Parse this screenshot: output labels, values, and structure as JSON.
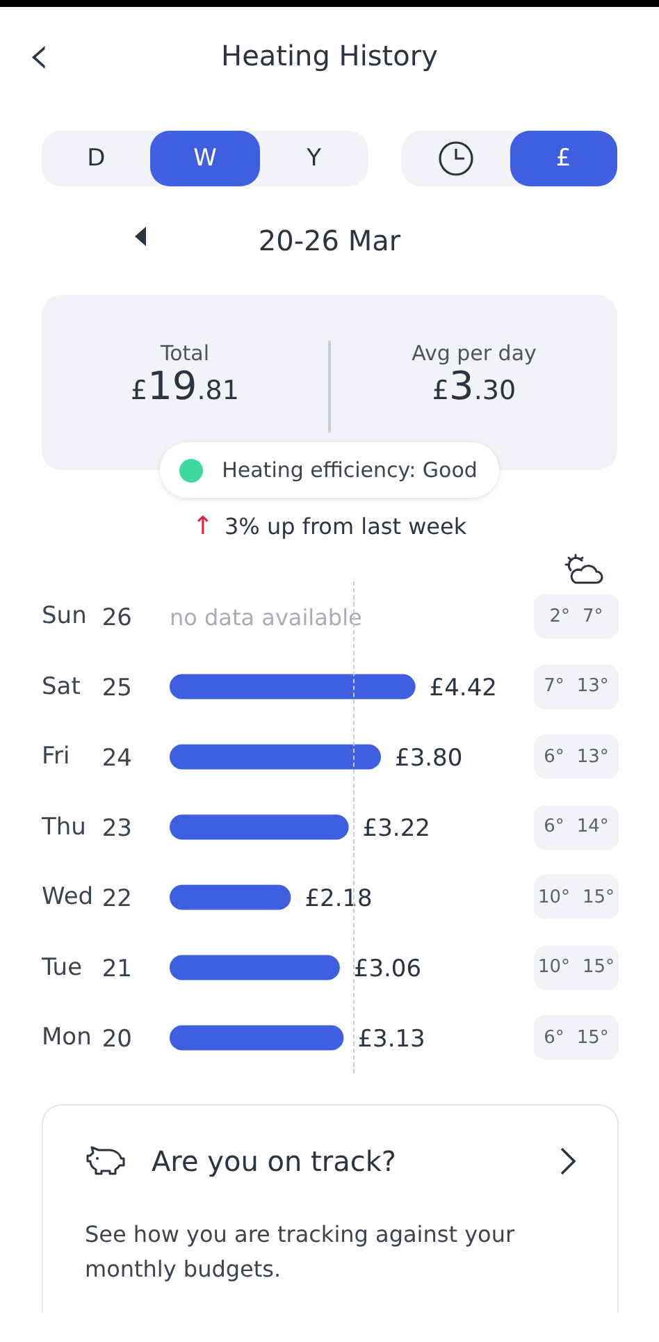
{
  "header": {
    "back_icon": "‹",
    "title": "Heating History"
  },
  "period_tabs": [
    {
      "label": "D",
      "selected": false
    },
    {
      "label": "W",
      "selected": true
    },
    {
      "label": "Y",
      "selected": false
    }
  ],
  "unit_tabs": [
    {
      "kind": "clock",
      "selected": false
    },
    {
      "kind": "currency",
      "label": "£",
      "selected": true
    }
  ],
  "range": {
    "label": "20-26 Mar"
  },
  "summary": [
    {
      "label": "Total",
      "prefix": "£",
      "major": "19",
      "minor": ".81"
    },
    {
      "label": "Avg per day",
      "prefix": "£",
      "major": "3",
      "minor": ".30"
    }
  ],
  "efficiency": {
    "text": "Heating efficiency: Good",
    "color": "#3ed9a0"
  },
  "trend": {
    "icon": "↑",
    "text": "3% up from last week"
  },
  "days": [
    {
      "day": "Sun",
      "note": "no data available",
      "low": "2°",
      "high": "7°"
    },
    {
      "day": "Sat",
      "low": "7°",
      "high": "13°"
    },
    {
      "day": "Fri",
      "low": "6°",
      "high": "13°"
    },
    {
      "day": "Thu",
      "low": "6°",
      "high": "14°"
    },
    {
      "day": "Wed",
      "low": "10°",
      "high": "15°"
    },
    {
      "day": "Tue",
      "low": "10°",
      "high": "15°"
    },
    {
      "day": "Mon",
      "low": "6°",
      "high": "15°"
    }
  ],
  "chart_data": {
    "type": "bar",
    "orientation": "horizontal",
    "categories": [
      "26",
      "25",
      "24",
      "23",
      "22",
      "21",
      "20"
    ],
    "values": [
      null,
      4.42,
      3.8,
      3.22,
      2.18,
      3.06,
      3.13
    ],
    "value_labels": [
      null,
      "£4.42",
      "£3.80",
      "£3.22",
      "£2.18",
      "£3.06",
      "£3.13"
    ]
  },
  "track_card": {
    "title": "Are you on track?",
    "text": "See how you are tracking against your monthly budgets."
  }
}
